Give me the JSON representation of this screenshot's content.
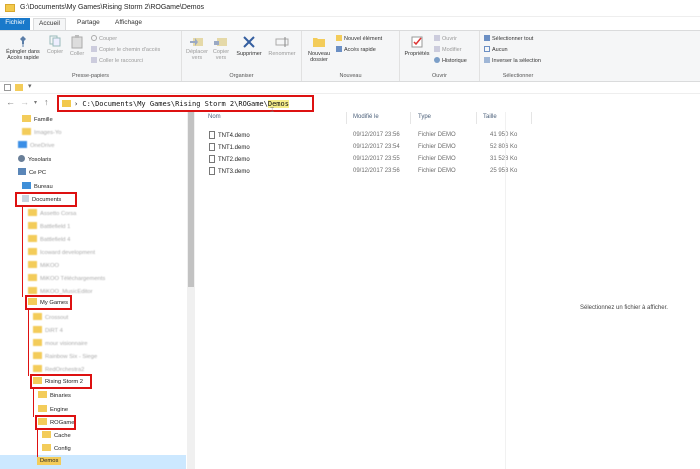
{
  "title_bar": {
    "title": "G:\\Documents\\My Games\\Rising Storm 2\\ROGame\\Demos"
  },
  "tabs": [
    "Fichier",
    "Accueil",
    "Partage",
    "Affichage"
  ],
  "ribbon": {
    "presse_papiers": {
      "label": "Presse-papiers",
      "pin": [
        "Épingler dans",
        "Accès rapide"
      ],
      "copier": "Copier",
      "coller": "Coller",
      "couper": "Couper",
      "copier_chemin": "Copier le chemin d'accès",
      "coller_raccourci": "Coller le raccourci"
    },
    "organiser": {
      "label": "Organiser",
      "deplacer": [
        "Déplacer",
        "vers"
      ],
      "copier_vers": [
        "Copier",
        "vers"
      ],
      "supprimer": "Supprimer",
      "renommer": "Renommer"
    },
    "nouveau": {
      "label": "Nouveau",
      "nouveau_dossier": [
        "Nouveau",
        "dossier"
      ],
      "nouvel_element": "Nouvel élément",
      "acces_rapide": "Accès rapide"
    },
    "ouvrir": {
      "label": "Ouvrir",
      "proprietes": "Propriétés",
      "ouvrir": "Ouvrir",
      "modifier": "Modifier",
      "historique": "Historique"
    },
    "selection": {
      "label": "Sélectionner",
      "tout": "Sélectionner tout",
      "aucun": "Aucun",
      "inverser": "Inverser la sélection"
    }
  },
  "address": {
    "prefix": "› C:\\Documents\\My Games\\Rising Storm 2\\ROGame\\",
    "current": "Demos"
  },
  "sidebar": {
    "items": [
      "Famille",
      "Images-Yo",
      "OneDrive",
      "Yosolaris",
      "Ce PC",
      "Bureau",
      "Documents",
      "Assetto Corsa",
      "Battlefield 1",
      "Battlefield 4",
      "Icoward development",
      "MiKOO",
      "MiKOO Téléchargements",
      "MiKOO_MusicEditor",
      "My Games",
      "Crossout",
      "DiRT 4",
      "mour visionnaire",
      "Rainbow Six - Siege",
      "RedOrchestra2",
      "Rising Storm 2",
      "Binaries",
      "Engine",
      "ROGame",
      "Cache",
      "Config",
      "Demos"
    ]
  },
  "columns": {
    "name": "Nom",
    "modified": "Modifié le",
    "type": "Type",
    "size": "Taille"
  },
  "files": [
    {
      "name": "TNT4.demo",
      "date": "09/12/2017 23:56",
      "type": "Fichier DEMO",
      "size": "41 950 Ko"
    },
    {
      "name": "TNT1.demo",
      "date": "09/12/2017 23:54",
      "type": "Fichier DEMO",
      "size": "52 806 Ko"
    },
    {
      "name": "TNT2.demo",
      "date": "09/12/2017 23:55",
      "type": "Fichier DEMO",
      "size": "31 528 Ko"
    },
    {
      "name": "TNT3.demo",
      "date": "09/12/2017 23:56",
      "type": "Fichier DEMO",
      "size": "25 958 Ko"
    }
  ],
  "preview_text": "Sélectionnez un fichier à afficher.",
  "colors": {
    "accent": "#1979ca",
    "annotation": "#d11111",
    "folder": "#f3cc5a"
  }
}
